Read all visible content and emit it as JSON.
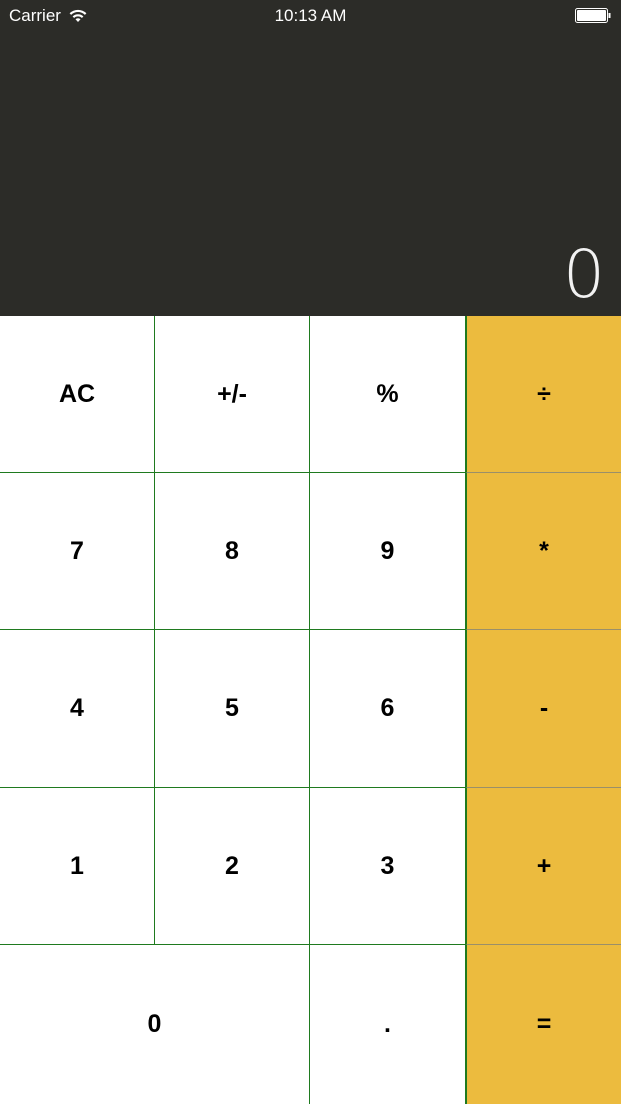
{
  "status_bar": {
    "carrier": "Carrier",
    "time": "10:13 AM",
    "wifi_icon": "wifi-icon",
    "battery_icon": "battery-icon"
  },
  "display": {
    "value": "0"
  },
  "keys": {
    "ac": "AC",
    "sign": "+/-",
    "percent": "%",
    "divide": "÷",
    "seven": "7",
    "eight": "8",
    "nine": "9",
    "multiply": "*",
    "four": "4",
    "five": "5",
    "six": "6",
    "minus": "-",
    "one": "1",
    "two": "2",
    "three": "3",
    "plus": "+",
    "zero": "0",
    "decimal": ".",
    "equals": "="
  },
  "colors": {
    "display_bg": "#2c2c28",
    "key_bg": "#ffffff",
    "operator_bg": "#ecbb3e",
    "key_border": "#1f7a1f",
    "display_text": "#f2f2f2"
  }
}
